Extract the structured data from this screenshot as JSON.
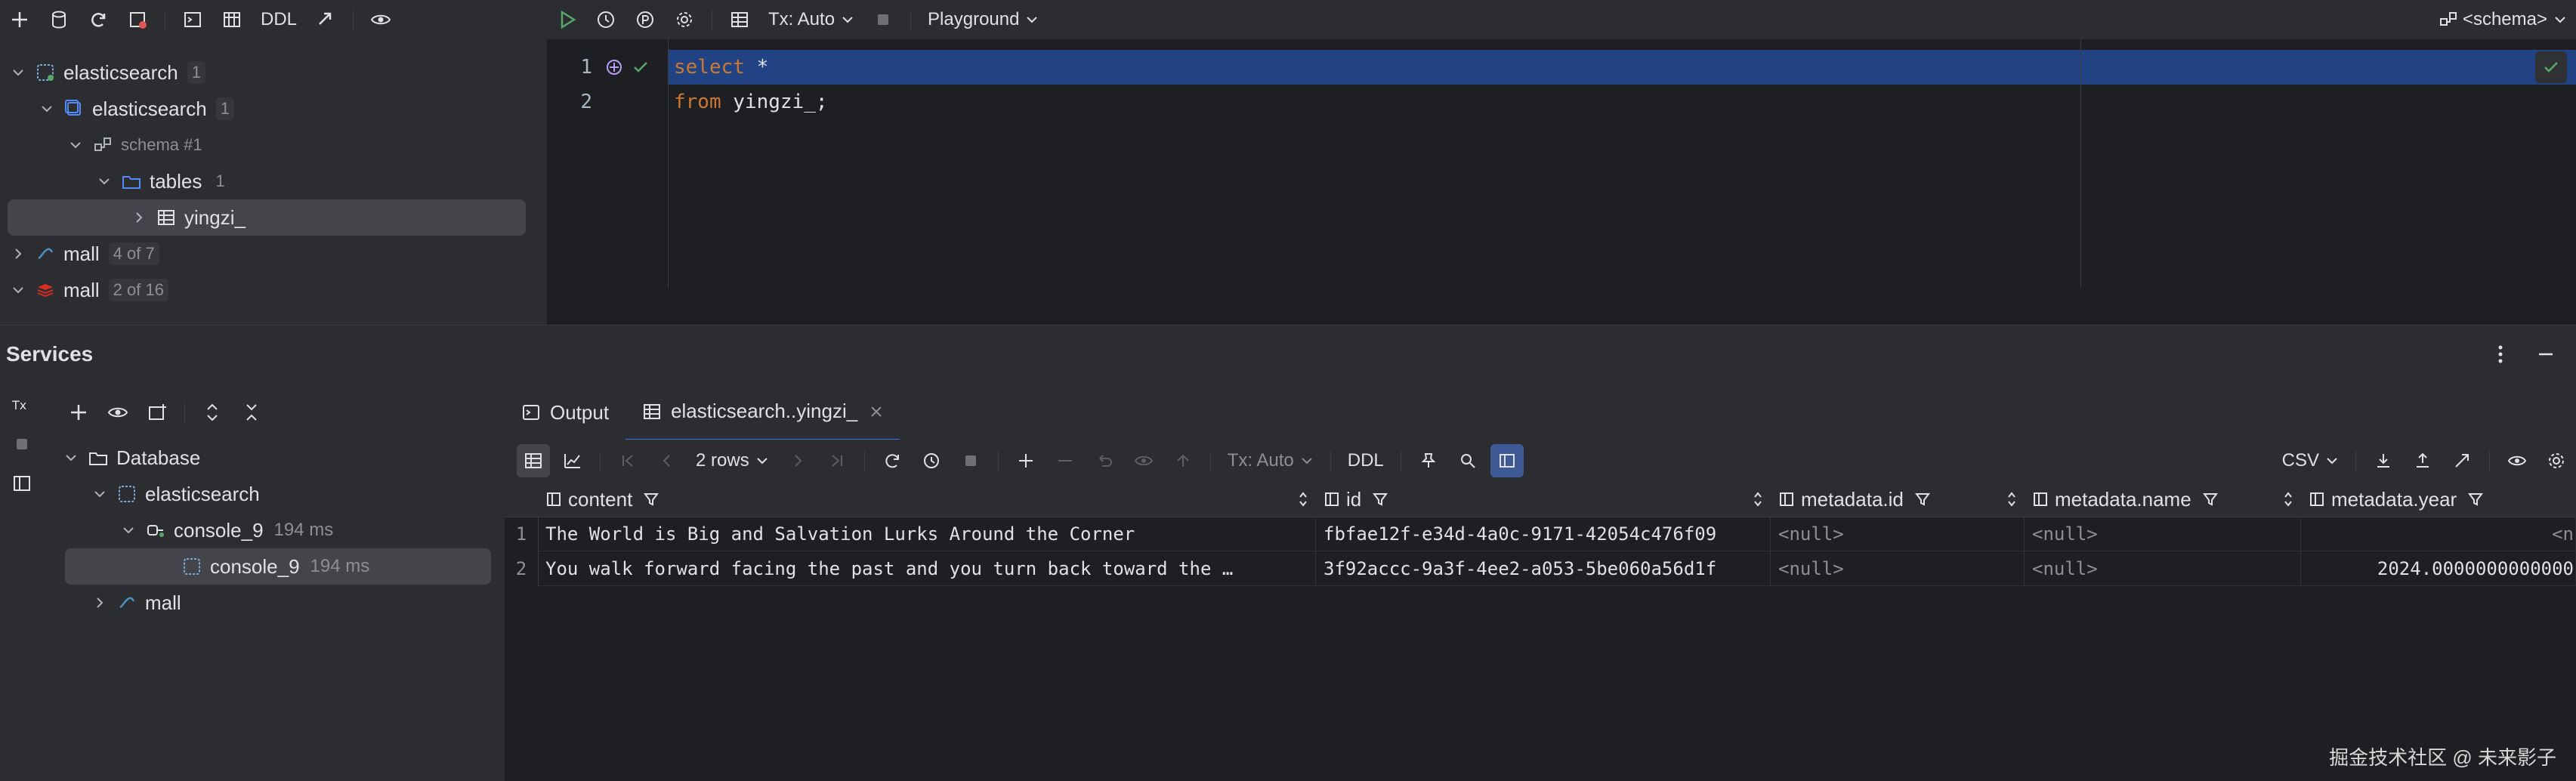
{
  "left_toolbar": {
    "ddl_label": "DDL"
  },
  "editor_toolbar": {
    "tx_label": "Tx: Auto",
    "playground_label": "Playground",
    "schema_label": "<schema>"
  },
  "left_tree": {
    "items": [
      {
        "label": "elasticsearch",
        "badge": "1"
      },
      {
        "label": "elasticsearch",
        "badge": "1"
      },
      {
        "label": "schema #1",
        "badge": ""
      },
      {
        "label": "tables",
        "badge": "1"
      },
      {
        "label": "yingzi_",
        "badge": ""
      },
      {
        "label": "mall",
        "badge": "4 of 7"
      },
      {
        "label": "mall",
        "badge": "2 of 16"
      }
    ]
  },
  "editor": {
    "lines": [
      {
        "num": "1",
        "kw": "select",
        "rest": " *"
      },
      {
        "num": "2",
        "kw": "from",
        "rest": " yingzi_;"
      }
    ]
  },
  "services": {
    "title": "Services",
    "tree": [
      {
        "label": "Database",
        "time": ""
      },
      {
        "label": "elasticsearch",
        "time": ""
      },
      {
        "label": "console_9",
        "time": "194 ms"
      },
      {
        "label": "console_9",
        "time": "194 ms"
      },
      {
        "label": "mall",
        "time": ""
      }
    ]
  },
  "results": {
    "tabs": [
      {
        "label": "Output"
      },
      {
        "label": "elasticsearch..yingzi_"
      }
    ],
    "toolbar": {
      "rows_label": "2 rows",
      "tx_label": "Tx: Auto",
      "ddl_label": "DDL",
      "csv_label": "CSV"
    },
    "columns": [
      {
        "name": "content"
      },
      {
        "name": "id"
      },
      {
        "name": "metadata.id"
      },
      {
        "name": "metadata.name"
      },
      {
        "name": "metadata.year"
      }
    ],
    "rows": [
      {
        "num": "1",
        "content": "The World is Big and Salvation Lurks Around the Corner",
        "id": "fbfae12f-e34d-4a0c-9171-42054c476f09",
        "meta_id": "<null>",
        "meta_name": "<null>",
        "meta_year": "<n"
      },
      {
        "num": "2",
        "content": "You walk forward facing the past and you turn back toward the …",
        "id": "3f92accc-9a3f-4ee2-a053-5be060a56d1f",
        "meta_id": "<null>",
        "meta_name": "<null>",
        "meta_year": "2024.0000000000000"
      }
    ]
  },
  "watermark": "掘金技术社区 @ 未来影子"
}
